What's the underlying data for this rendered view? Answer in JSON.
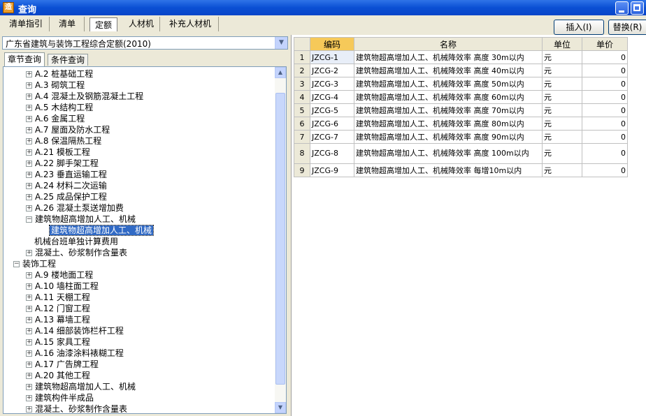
{
  "window": {
    "title": "查询",
    "app_icon_glyph": "造"
  },
  "tabs": [
    "清单指引",
    "清单",
    "定额",
    "人材机",
    "补充人材机"
  ],
  "active_tab": "定额",
  "buttons": {
    "insert": "插入(I)",
    "replace": "替换(R)"
  },
  "left": {
    "combo_value": "广东省建筑与装饰工程综合定额(2010)",
    "subtabs": [
      "章节查询",
      "条件查询"
    ],
    "tree": [
      {
        "text": "A.2 桩基础工程",
        "toggle": "+"
      },
      {
        "text": "A.3 砌筑工程",
        "toggle": "+"
      },
      {
        "text": "A.4 混凝土及钢筋混凝土工程",
        "toggle": "+"
      },
      {
        "text": "A.5 木结构工程",
        "toggle": "+"
      },
      {
        "text": "A.6 金属工程",
        "toggle": "+"
      },
      {
        "text": "A.7 屋面及防水工程",
        "toggle": "+"
      },
      {
        "text": "A.8 保温隔热工程",
        "toggle": "+"
      },
      {
        "text": "A.21 模板工程",
        "toggle": "+"
      },
      {
        "text": "A.22 脚手架工程",
        "toggle": "+"
      },
      {
        "text": "A.23 垂直运输工程",
        "toggle": "+"
      },
      {
        "text": "A.24 材料二次运输",
        "toggle": "+"
      },
      {
        "text": "A.25 成品保护工程",
        "toggle": "+"
      },
      {
        "text": "A.26 混凝土泵送增加费",
        "toggle": "+"
      },
      {
        "text": "建筑物超高增加人工、机械",
        "toggle": "−"
      },
      {
        "text": "建筑物超高增加人工、机械",
        "toggle": ""
      },
      {
        "text": "机械台班单独计算费用",
        "toggle": ""
      },
      {
        "text": "混凝土、砂浆制作含量表",
        "toggle": "+"
      },
      {
        "text": "装饰工程",
        "toggle": "−"
      },
      {
        "text": "A.9 楼地面工程",
        "toggle": "+"
      },
      {
        "text": "A.10 墙柱面工程",
        "toggle": "+"
      },
      {
        "text": "A.11 天棚工程",
        "toggle": "+"
      },
      {
        "text": "A.12 门窗工程",
        "toggle": "+"
      },
      {
        "text": "A.13 幕墙工程",
        "toggle": "+"
      },
      {
        "text": "A.14 细部装饰栏杆工程",
        "toggle": "+"
      },
      {
        "text": "A.15 家具工程",
        "toggle": "+"
      },
      {
        "text": "A.16 油漆涂料裱糊工程",
        "toggle": "+"
      },
      {
        "text": "A.17 广告牌工程",
        "toggle": "+"
      },
      {
        "text": "A.20 其他工程",
        "toggle": "+"
      },
      {
        "text": "建筑物超高增加人工、机械",
        "toggle": "+"
      },
      {
        "text": "建筑构件半成品",
        "toggle": "+"
      },
      {
        "text": "混凝土、砂浆制作含量表",
        "toggle": "+"
      }
    ]
  },
  "grid": {
    "headers": [
      "编码",
      "名称",
      "单位",
      "单价"
    ],
    "rows": [
      {
        "n": "1",
        "code": "JZCG-1",
        "name": "建筑物超高增加人工、机械降效率 高度 30m以内",
        "unit": "元",
        "price": "0"
      },
      {
        "n": "2",
        "code": "JZCG-2",
        "name": "建筑物超高增加人工、机械降效率 高度 40m以内",
        "unit": "元",
        "price": "0"
      },
      {
        "n": "3",
        "code": "JZCG-3",
        "name": "建筑物超高增加人工、机械降效率 高度 50m以内",
        "unit": "元",
        "price": "0"
      },
      {
        "n": "4",
        "code": "JZCG-4",
        "name": "建筑物超高增加人工、机械降效率 高度 60m以内",
        "unit": "元",
        "price": "0"
      },
      {
        "n": "5",
        "code": "JZCG-5",
        "name": "建筑物超高增加人工、机械降效率 高度 70m以内",
        "unit": "元",
        "price": "0"
      },
      {
        "n": "6",
        "code": "JZCG-6",
        "name": "建筑物超高增加人工、机械降效率 高度 80m以内",
        "unit": "元",
        "price": "0"
      },
      {
        "n": "7",
        "code": "JZCG-7",
        "name": "建筑物超高增加人工、机械降效率 高度 90m以内",
        "unit": "元",
        "price": "0"
      },
      {
        "n": "8",
        "code": "JZCG-8",
        "name": "建筑物超高增加人工、机械降效率 高度 100m以内",
        "unit": "元",
        "price": "0"
      },
      {
        "n": "9",
        "code": "JZCG-9",
        "name": "建筑物超高增加人工、机械降效率 每增10m以内",
        "unit": "元",
        "price": "0"
      }
    ]
  }
}
